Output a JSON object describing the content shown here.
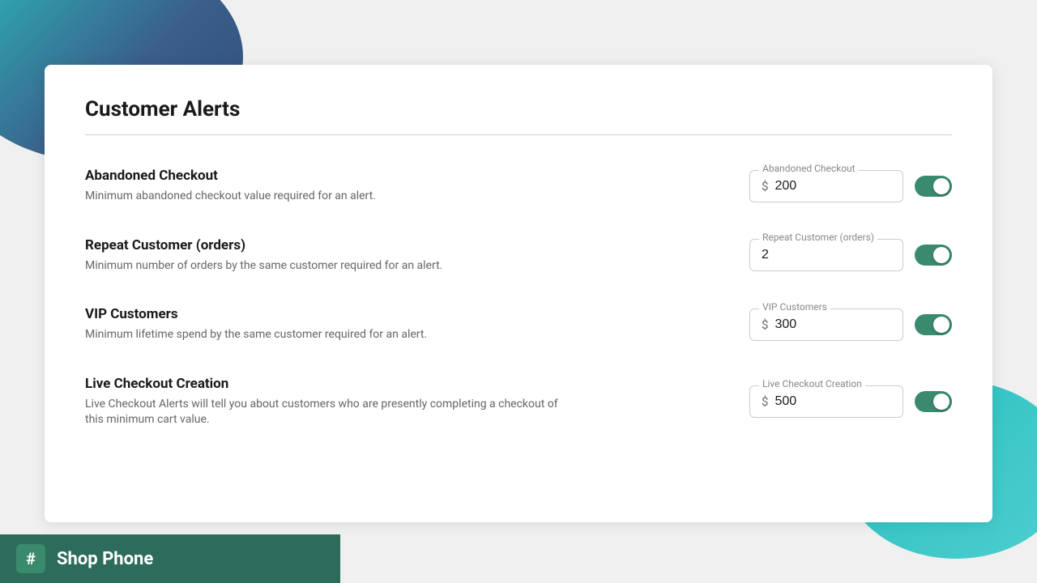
{
  "page": {
    "title": "Customer Alerts"
  },
  "branding": {
    "name": "Shop Phone",
    "hash": "#"
  },
  "alerts": [
    {
      "id": "abandoned-checkout",
      "title": "Abandoned Checkout",
      "description": "Minimum abandoned checkout value required for an alert.",
      "field_label": "Abandoned Checkout",
      "has_currency": true,
      "currency_symbol": "$",
      "value": "200",
      "enabled": true
    },
    {
      "id": "repeat-customer",
      "title": "Repeat Customer (orders)",
      "description": "Minimum number of orders by the same customer required for an alert.",
      "field_label": "Repeat Customer (orders)",
      "has_currency": false,
      "currency_symbol": "",
      "value": "2",
      "enabled": true
    },
    {
      "id": "vip-customers",
      "title": "VIP Customers",
      "description": "Minimum lifetime spend by the same customer required for an alert.",
      "field_label": "VIP Customers",
      "has_currency": true,
      "currency_symbol": "$",
      "value": "300",
      "enabled": true
    },
    {
      "id": "live-checkout",
      "title": "Live Checkout Creation",
      "description": "Live Checkout Alerts will tell you about customers who are presently completing a checkout of this minimum cart value.",
      "field_label": "Live Checkout Creation",
      "has_currency": true,
      "currency_symbol": "$",
      "value": "500",
      "enabled": true
    }
  ]
}
